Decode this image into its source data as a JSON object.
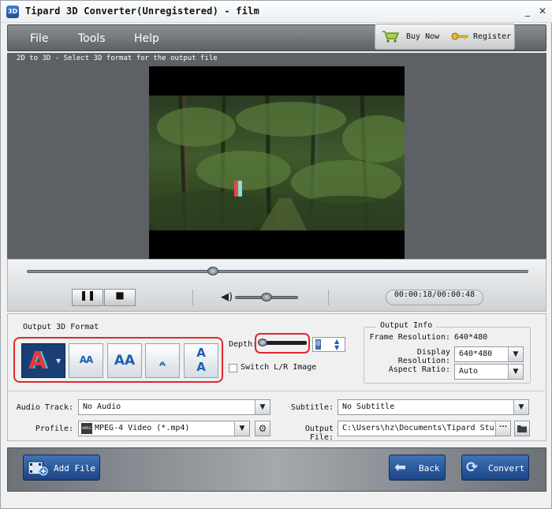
{
  "window": {
    "title": "Tipard 3D Converter(Unregistered) - film",
    "app_icon_text": "3D"
  },
  "menu": {
    "file": "File",
    "tools": "Tools",
    "help": "Help"
  },
  "toolbar": {
    "buy_now": "Buy Now",
    "register": "Register"
  },
  "preview": {
    "caption": "2D to 3D - Select 3D format for the output file"
  },
  "player": {
    "seek_progress": 0.37,
    "volume_level": 0.45,
    "time_display": "00:00:18/00:00:48"
  },
  "format": {
    "label": "Output 3D Format",
    "depth_label": "Depth:",
    "depth_value": "0",
    "switch_label": "Switch L/R Image",
    "buttons": [
      {
        "name": "anaglyph",
        "glyph": "A"
      },
      {
        "name": "side-by-side-half",
        "glyph": "AA"
      },
      {
        "name": "side-by-side-full",
        "glyph": "AA"
      },
      {
        "name": "top-bottom-half",
        "glyph": "A"
      },
      {
        "name": "top-bottom-full",
        "glyph": "A"
      }
    ]
  },
  "output_info": {
    "title": "Output Info",
    "frame_resolution_label": "Frame Resolution:",
    "frame_resolution_value": "640*480",
    "display_resolution_label": "Display Resolution:",
    "display_resolution_value": "640*480",
    "aspect_ratio_label": "Aspect Ratio:",
    "aspect_ratio_value": "Auto"
  },
  "settings": {
    "audio_track_label": "Audio Track:",
    "audio_track_value": "No Audio",
    "subtitle_label": "Subtitle:",
    "subtitle_value": "No Subtitle",
    "profile_label": "Profile:",
    "profile_value": "MPEG-4 Video (*.mp4)",
    "profile_icon_text": "MPEG",
    "output_file_label": "Output File:",
    "output_file_value": "C:\\Users\\hz\\Documents\\Tipard Studio\\",
    "browse_label": "...",
    "dropdown_arrow": "▼"
  },
  "actions": {
    "add_file": "Add File",
    "back": "Back",
    "convert": "Convert"
  }
}
